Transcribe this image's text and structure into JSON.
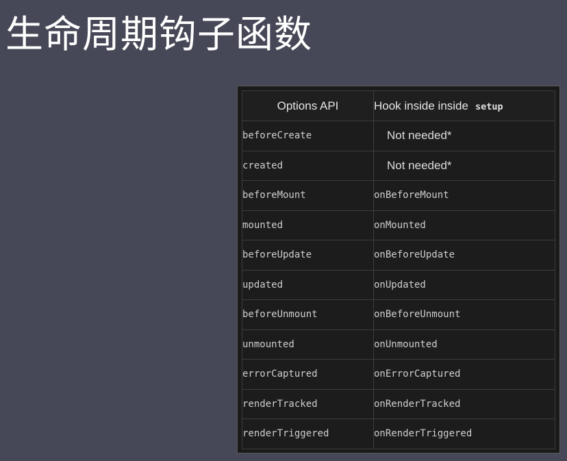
{
  "title": "生命周期钩子函数",
  "table": {
    "header_options": "Options API",
    "header_hook": "Hook inside inside",
    "header_hook_code": "setup",
    "rows": [
      {
        "option": "beforeCreate",
        "hook": "Not needed*",
        "hook_is_code": false
      },
      {
        "option": "created",
        "hook": "Not needed*",
        "hook_is_code": false
      },
      {
        "option": "beforeMount",
        "hook": "onBeforeMount",
        "hook_is_code": true
      },
      {
        "option": "mounted",
        "hook": "onMounted",
        "hook_is_code": true
      },
      {
        "option": "beforeUpdate",
        "hook": "onBeforeUpdate",
        "hook_is_code": true
      },
      {
        "option": "updated",
        "hook": "onUpdated",
        "hook_is_code": true
      },
      {
        "option": "beforeUnmount",
        "hook": "onBeforeUnmount",
        "hook_is_code": true
      },
      {
        "option": "unmounted",
        "hook": "onUnmounted",
        "hook_is_code": true
      },
      {
        "option": "errorCaptured",
        "hook": "onErrorCaptured",
        "hook_is_code": true
      },
      {
        "option": "renderTracked",
        "hook": "onRenderTracked",
        "hook_is_code": true
      },
      {
        "option": "renderTriggered",
        "hook": "onRenderTriggered",
        "hook_is_code": true
      }
    ]
  },
  "colors": {
    "background": "#474857",
    "table_background": "#1c1c1c",
    "text": "#cfcfcf",
    "title": "#ffffff"
  }
}
